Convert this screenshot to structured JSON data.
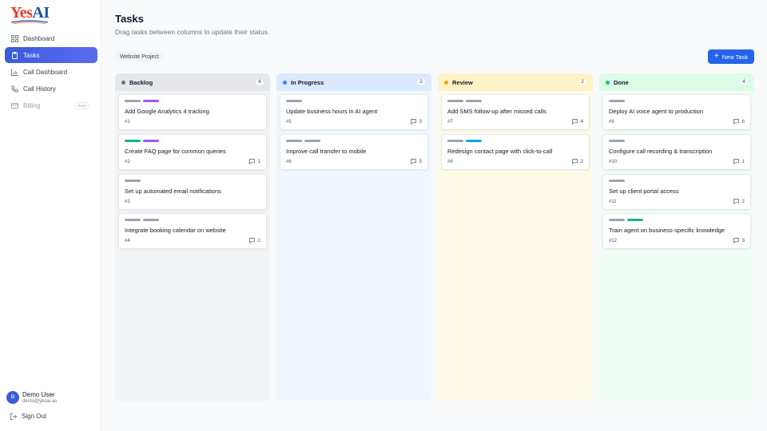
{
  "app": {
    "logo": {
      "part1": "Yes",
      "part2": "AI"
    }
  },
  "sidebar": {
    "items": [
      {
        "label": "Dashboard",
        "icon": "dashboard-grid-icon"
      },
      {
        "label": "Tasks",
        "icon": "clipboard-icon",
        "active": true
      },
      {
        "label": "Call Dashboard",
        "icon": "bar-chart-icon"
      },
      {
        "label": "Call History",
        "icon": "phone-icon"
      },
      {
        "label": "Billing",
        "icon": "credit-card-icon",
        "disabled": true,
        "badge": "Soon"
      }
    ],
    "user": {
      "initial": "D",
      "name": "Demo User",
      "email": "demo@yesai.au"
    },
    "signout_label": "Sign Out"
  },
  "header": {
    "title": "Tasks",
    "subtitle": "Drag tasks between columns to update their status.",
    "project_label": "Website Project",
    "new_task_label": "New Task"
  },
  "colors": {
    "accent": "#2563eb",
    "tag_gray": "#9ca3af",
    "tag_purple": "#a855f7",
    "tag_green": "#10b981",
    "tag_blue": "#0ea5e9"
  },
  "columns": [
    {
      "title": "Backlog",
      "count": "4",
      "dot": "#6b7280",
      "bg": "#f2f3f5",
      "header_bg": "#e5e7eb",
      "cards": [
        {
          "title": "Add Google Analytics 4 tracking",
          "id": "#1",
          "comments": "",
          "tags": [
            "#9ca3af",
            "#a855f7"
          ]
        },
        {
          "title": "Create FAQ page for common queries",
          "id": "#2",
          "comments": "1",
          "tags": [
            "#10b981",
            "#a855f7"
          ]
        },
        {
          "title": "Set up automated email notifications",
          "id": "#3",
          "comments": "",
          "tags": [
            "#9ca3af"
          ]
        },
        {
          "title": "Integrate booking calendar on website",
          "id": "#4",
          "comments": "2",
          "tags": [
            "#9ca3af",
            "#9ca3af"
          ]
        }
      ]
    },
    {
      "title": "In Progress",
      "count": "2",
      "dot": "#3b82f6",
      "bg": "#eff6ff",
      "header_bg": "#dbeafe",
      "cards": [
        {
          "title": "Update business hours in AI agent",
          "id": "#5",
          "comments": "3",
          "tags": [
            "#9ca3af"
          ]
        },
        {
          "title": "Improve call transfer to mobile",
          "id": "#6",
          "comments": "5",
          "tags": [
            "#9ca3af",
            "#9ca3af"
          ]
        }
      ]
    },
    {
      "title": "Review",
      "count": "2",
      "dot": "#f59e0b",
      "bg": "#fefce8",
      "header_bg": "#fef3c7",
      "cards": [
        {
          "title": "Add SMS follow-up after missed calls",
          "id": "#7",
          "comments": "4",
          "tags": [
            "#9ca3af",
            "#9ca3af"
          ]
        },
        {
          "title": "Redesign contact page with click-to-call",
          "id": "#8",
          "comments": "2",
          "tags": [
            "#9ca3af",
            "#0ea5e9"
          ]
        }
      ]
    },
    {
      "title": "Done",
      "count": "4",
      "dot": "#22c55e",
      "bg": "#f0fdf4",
      "header_bg": "#dcfce7",
      "cards": [
        {
          "title": "Deploy AI voice agent to production",
          "id": "#9",
          "comments": "6",
          "tags": [
            "#9ca3af"
          ]
        },
        {
          "title": "Configure call recording & transcription",
          "id": "#10",
          "comments": "1",
          "tags": [
            "#9ca3af"
          ]
        },
        {
          "title": "Set up client portal access",
          "id": "#11",
          "comments": "2",
          "tags": [
            "#9ca3af"
          ]
        },
        {
          "title": "Train agent on business-specific knowledge",
          "id": "#12",
          "comments": "3",
          "tags": [
            "#9ca3af",
            "#10b981"
          ]
        }
      ]
    }
  ]
}
